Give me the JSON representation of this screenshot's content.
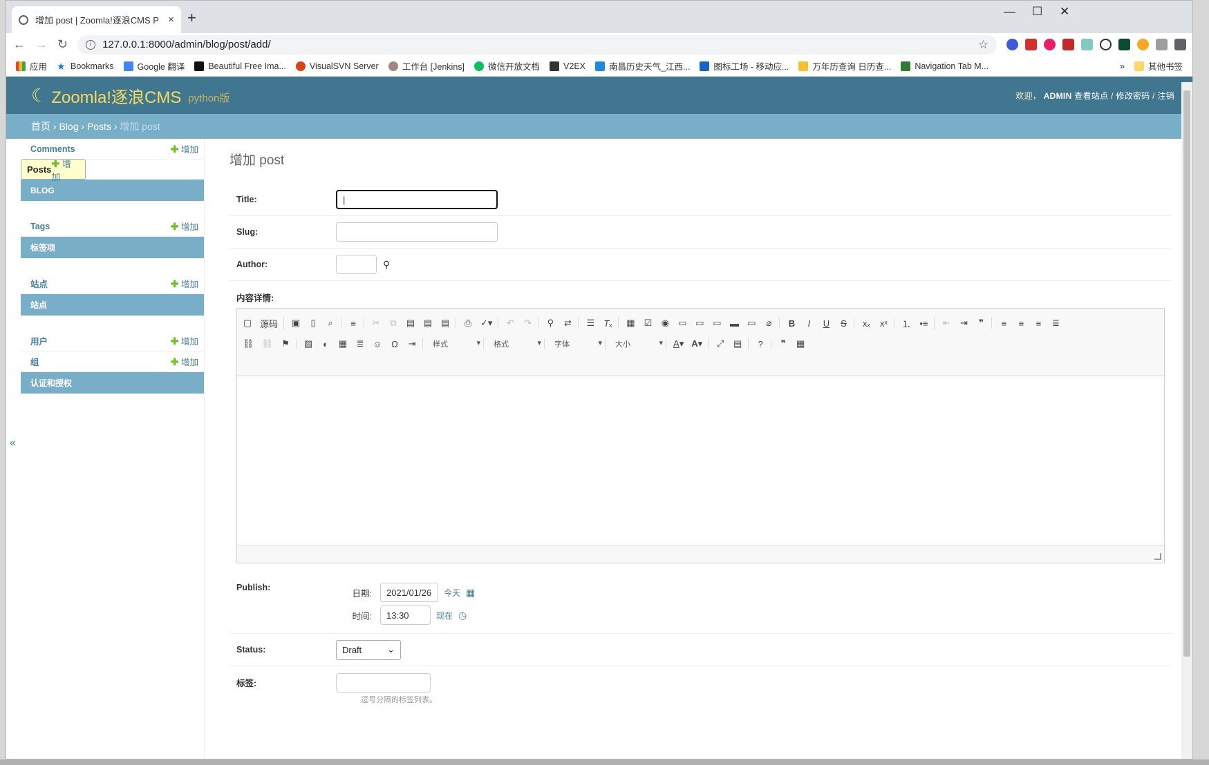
{
  "browser": {
    "tab_title": "增加 post | Zoomla!逐浪CMS P",
    "tab_close": "×",
    "new_tab": "+",
    "win_controls": [
      "—",
      "☐",
      "✕"
    ],
    "url": "127.0.0.1:8000/admin/blog/post/add/",
    "bookmarks": [
      "应用",
      "Bookmarks",
      "Google 翻译",
      "Beautiful Free Ima...",
      "VisualSVN Server",
      "工作台 [Jenkins]",
      "微信开放文档",
      "V2EX",
      "南昌历史天气_江西...",
      "图标工场 - 移动应...",
      "万年历查询 日历查...",
      "Navigation Tab M..."
    ],
    "bookmarks_more": "»",
    "other_bookmarks": "其他书签",
    "colors": {
      "tabbar": "#dee1e6",
      "header": "#417690",
      "crumbs": "#79aec8"
    }
  },
  "header": {
    "brand": "Zoomla!逐浪CMS",
    "brand_sub": "python版",
    "welcome": "欢迎，",
    "user": "ADMIN",
    "view_site": "查看站点",
    "change_password": "修改密码",
    "logout": "注销",
    "sep": " / "
  },
  "breadcrumb": {
    "home": "首页",
    "app": "Blog",
    "model": "Posts",
    "current": "增加 post",
    "sep": " › "
  },
  "sidebar": {
    "add_label": "增加",
    "toggle": "«",
    "modules": [
      {
        "rows": [
          {
            "label": "Comments",
            "add": true
          },
          {
            "label": "Posts",
            "add": true,
            "selected": true
          }
        ],
        "caption": "BLOG"
      },
      {
        "rows": [
          {
            "label": "Tags",
            "add": true
          }
        ],
        "caption": "标签项"
      },
      {
        "rows": [
          {
            "label": "站点",
            "add": true
          }
        ],
        "caption": "站点"
      },
      {
        "rows": [
          {
            "label": "用户",
            "add": true
          },
          {
            "label": "组",
            "add": true
          }
        ],
        "caption": "认证和授权"
      }
    ]
  },
  "form": {
    "title": "增加 post",
    "title_label": "Title:",
    "slug_label": "Slug:",
    "author_label": "Author:",
    "content_label": "内容详情:",
    "editor": {
      "source": "源码",
      "combos": [
        "样式",
        "格式",
        "字体",
        "大小"
      ]
    },
    "publish_label": "Publish:",
    "date_label": "日期:",
    "date_value": "2021/01/26",
    "today": "今天",
    "time_label": "时间:",
    "time_value": "13:30",
    "now": "现在",
    "status_label": "Status:",
    "status_value": "Draft",
    "tags_label": "标签:",
    "tags_help": "逗号分隔的标签列表。"
  }
}
